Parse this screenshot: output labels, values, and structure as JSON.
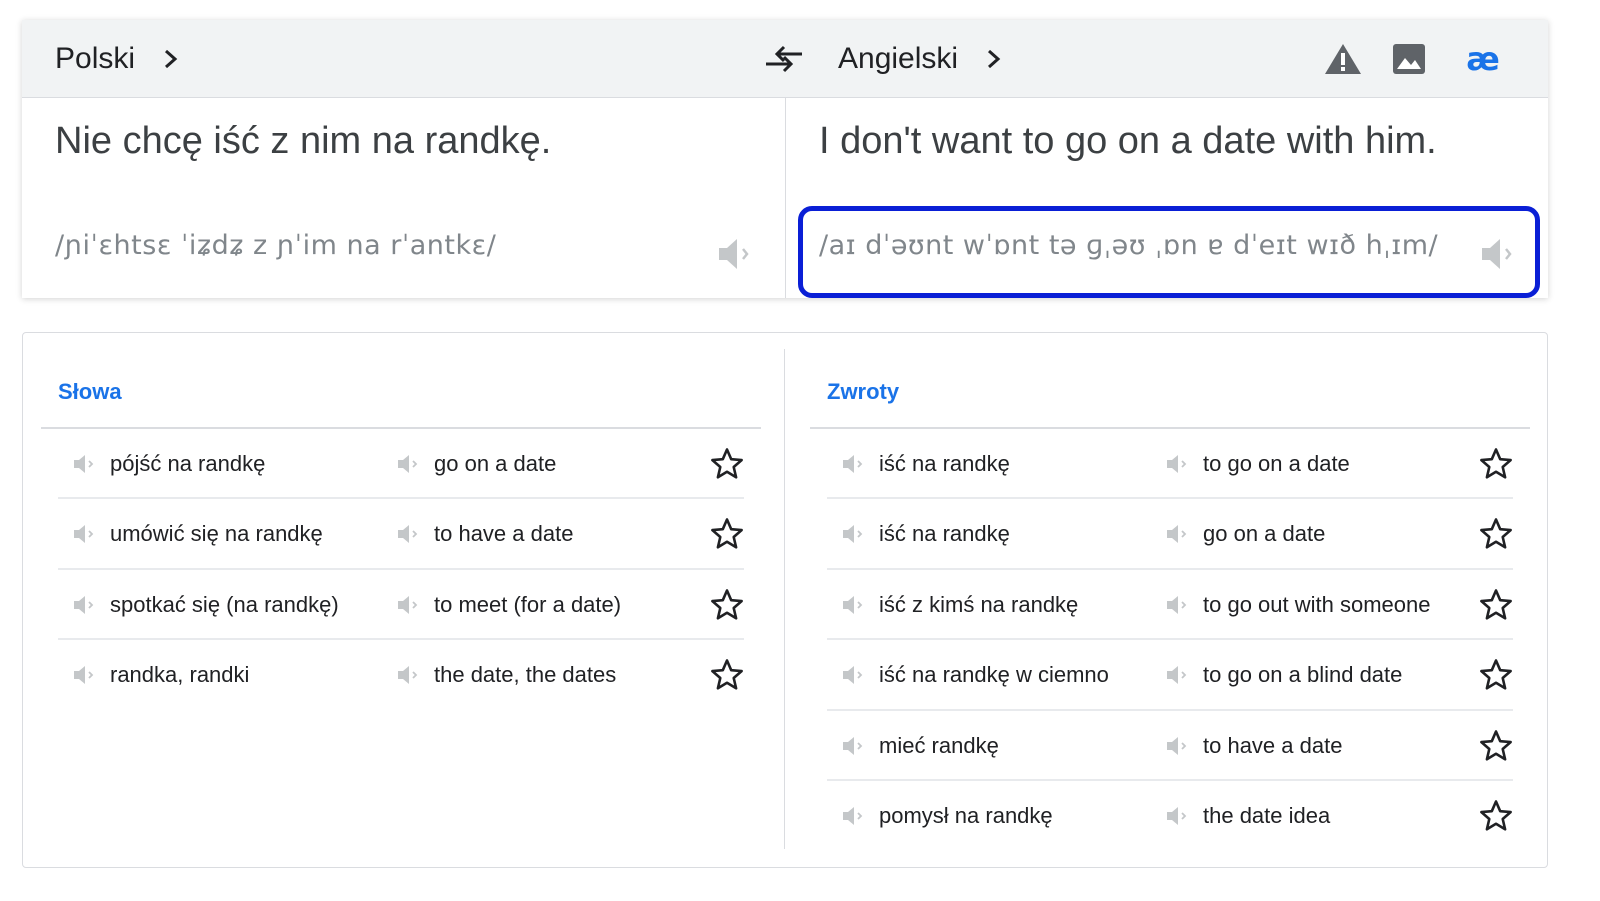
{
  "lang_bar": {
    "source_lang": "Polski",
    "target_lang": "Angielski",
    "icons": [
      "chevron-right-icon",
      "swap-icon",
      "warning-icon",
      "image-icon",
      "phonetics-icon"
    ],
    "phonetics_label": "æ",
    "accent_color": "#1a73e8"
  },
  "source": {
    "text": "Nie chcę iść z nim na randkę.",
    "ipa": "/ɲiˈɛhtsɛ ˈiʑdʑ z ɲˈim na rˈantkɛ/"
  },
  "target": {
    "text": "I don't want to go on a date with him.",
    "ipa": "/aɪ dˈəʊnt wˈɒnt tə ɡˌəʊ ˌɒn ɐ dˈeɪt wɪð hˌɪm/"
  },
  "words": {
    "title": "Słowa",
    "rows": [
      {
        "source": "pójść na randkę",
        "target": "go on a date"
      },
      {
        "source": "umówić się na randkę",
        "target": "to have a date"
      },
      {
        "source": "spotkać się (na randkę)",
        "target": "to meet (for a date)"
      },
      {
        "source": "randka, randki",
        "target": "the date, the dates"
      }
    ]
  },
  "phrases": {
    "title": "Zwroty",
    "rows": [
      {
        "source": "iść na randkę",
        "target": "to go on a date"
      },
      {
        "source": "iść na randkę",
        "target": "go on a date"
      },
      {
        "source": "iść z kimś na randkę",
        "target": "to go out with someone"
      },
      {
        "source": "iść na randkę w ciemno",
        "target": "to go on a blind date"
      },
      {
        "source": "mieć randkę",
        "target": "to have a date"
      },
      {
        "source": "pomysł na randkę",
        "target": "the date idea"
      }
    ]
  },
  "highlight_color": "#0a1fd6"
}
